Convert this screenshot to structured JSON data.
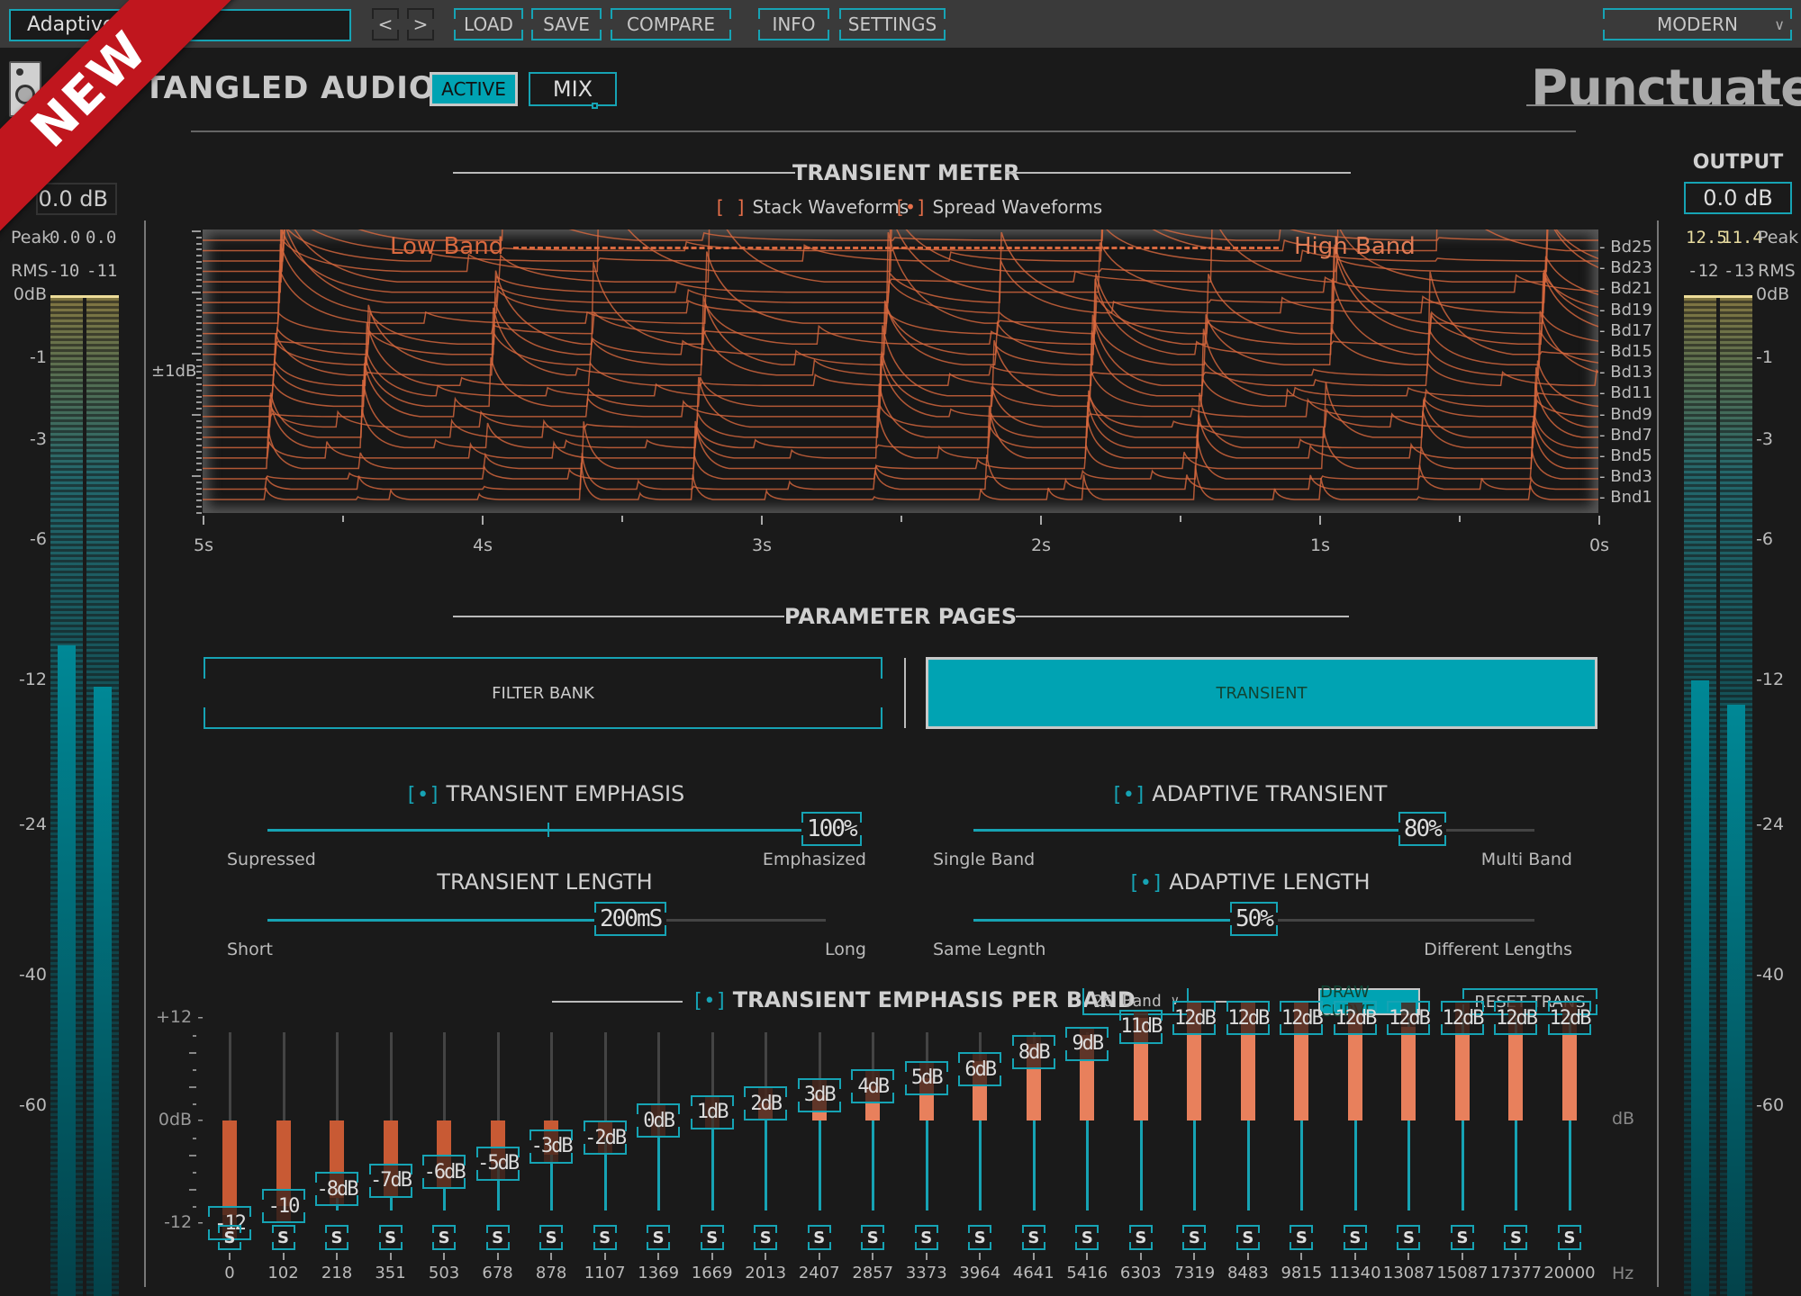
{
  "top_bar": {
    "preset_name": "Adaptive T",
    "prev_label": "<",
    "next_label": ">",
    "load_label": "LOAD",
    "save_label": "SAVE",
    "compare_label": "COMPARE",
    "info_label": "INFO",
    "settings_label": "SETTINGS",
    "style_selected": "MODERN",
    "chevron": "∨"
  },
  "ribbon": {
    "text": "NEW",
    "color": "#c0161e"
  },
  "header": {
    "brand": "TANGLED AUDIO",
    "active_label": "ACTIVE",
    "mix_label": "MIX",
    "plugin_name": "Punctuate"
  },
  "input_meter": {
    "gain_value": "0.0 dB",
    "peak_label": "Peak",
    "peak_l": "0.0",
    "peak_r": "0.0",
    "rms_label": "RMS",
    "rms_l": "-10",
    "rms_r": "-11",
    "scale": [
      "0dB",
      "-1",
      "-3",
      "-6",
      "-12",
      "-24",
      "-40",
      "-60"
    ],
    "level_l_db": -10.5,
    "level_r_db": -12.5
  },
  "output_meter": {
    "title": "OUTPUT",
    "gain_value": "0.0 dB",
    "peak_label": "Peak",
    "peak_l": "12.5",
    "peak_r": "11.4",
    "rms_label": "RMS",
    "rms_l": "-12",
    "rms_r": "-13",
    "scale": [
      "0dB",
      "-1",
      "-3",
      "-6",
      "-12",
      "-24",
      "-40",
      "-60"
    ],
    "level_l_db": -12,
    "level_r_db": -14
  },
  "transient_meter": {
    "title": "TRANSIENT METER",
    "stack_label": "Stack Waveforms",
    "stack_checked": false,
    "spread_label": "Spread Waveforms",
    "spread_checked": true,
    "y_label": "±1dB",
    "low_band_label": "Low Band",
    "high_band_label": "High Band",
    "band_labels": [
      "Bd25",
      "Bd23",
      "Bd21",
      "Bd19",
      "Bd17",
      "Bd15",
      "Bd13",
      "Bd11",
      "Bnd9",
      "Bnd7",
      "Bnd5",
      "Bnd3",
      "Bnd1"
    ],
    "time_labels": [
      "5s",
      "4s",
      "3s",
      "2s",
      "1s",
      "0s"
    ],
    "band_count": 26,
    "transient_times_s": [
      4.78,
      4.45,
      4.0,
      3.65,
      3.25,
      2.6,
      2.2,
      1.85,
      1.45,
      1.0,
      0.65,
      0.25
    ],
    "wave_color": "#d9693f"
  },
  "parameter_pages": {
    "title": "PARAMETER PAGES",
    "tabs": [
      {
        "label": "FILTER BANK",
        "active": false
      },
      {
        "label": "TRANSIENT",
        "active": true
      }
    ]
  },
  "params": {
    "transient_emphasis": {
      "title": "TRANSIENT EMPHASIS",
      "checkbox": "[•]",
      "value": "100%",
      "fraction": 1.0,
      "min_label": "Supressed",
      "max_label": "Emphasized"
    },
    "transient_length": {
      "title": "TRANSIENT LENGTH",
      "value": "200mS",
      "fraction": 0.65,
      "min_label": "Short",
      "max_label": "Long"
    },
    "adaptive_transient": {
      "title": "ADAPTIVE TRANSIENT",
      "checkbox": "[•]",
      "value": "80%",
      "fraction": 0.8,
      "min_label": "Single Band",
      "max_label": "Multi Band"
    },
    "adaptive_length": {
      "title": "ADAPTIVE LENGTH",
      "checkbox": "[•]",
      "value": "50%",
      "fraction": 0.5,
      "min_label": "Same Legnth",
      "max_label": "Different Lengths"
    }
  },
  "per_band": {
    "title": "TRANSIENT EMPHASIS PER BAND",
    "checkbox": "[•]",
    "band_mode": "26 Band",
    "draw_curve_label": "DRAW CURVE",
    "reset_label": "RESET TRANS",
    "y_labels": [
      "+12",
      "0dB",
      "-12"
    ],
    "unit_db": "dB",
    "unit_hz": "Hz",
    "solo_label": "S",
    "bands": [
      {
        "freq": "0",
        "value": "-12",
        "db": -12,
        "activity": -11
      },
      {
        "freq": "102",
        "value": "-10",
        "db": -10,
        "activity": -10
      },
      {
        "freq": "218",
        "value": "-8dB",
        "db": -8,
        "activity": -9
      },
      {
        "freq": "351",
        "value": "-7dB",
        "db": -7,
        "activity": -9
      },
      {
        "freq": "503",
        "value": "-6dB",
        "db": -6,
        "activity": -8
      },
      {
        "freq": "678",
        "value": "-5dB",
        "db": -5,
        "activity": -5
      },
      {
        "freq": "878",
        "value": "-3dB",
        "db": -3,
        "activity": -4
      },
      {
        "freq": "1107",
        "value": "-2dB",
        "db": -2,
        "activity": -2
      },
      {
        "freq": "1369",
        "value": "0dB",
        "db": 0,
        "activity": 0
      },
      {
        "freq": "1669",
        "value": "1dB",
        "db": 1,
        "activity": 0
      },
      {
        "freq": "2013",
        "value": "2dB",
        "db": 2,
        "activity": 2
      },
      {
        "freq": "2407",
        "value": "3dB",
        "db": 3,
        "activity": 3
      },
      {
        "freq": "2857",
        "value": "4dB",
        "db": 4,
        "activity": 4
      },
      {
        "freq": "3373",
        "value": "5dB",
        "db": 5,
        "activity": 5
      },
      {
        "freq": "3964",
        "value": "6dB",
        "db": 6,
        "activity": 7
      },
      {
        "freq": "4641",
        "value": "8dB",
        "db": 8,
        "activity": 9
      },
      {
        "freq": "5416",
        "value": "9dB",
        "db": 9,
        "activity": 10
      },
      {
        "freq": "6303",
        "value": "11dB",
        "db": 11,
        "activity": 12
      },
      {
        "freq": "7319",
        "value": "12dB",
        "db": 12,
        "activity": 14
      },
      {
        "freq": "8483",
        "value": "12dB",
        "db": 12,
        "activity": 14
      },
      {
        "freq": "9815",
        "value": "12dB",
        "db": 12,
        "activity": 14
      },
      {
        "freq": "11340",
        "value": "12dB",
        "db": 12,
        "activity": 12.5
      },
      {
        "freq": "13087",
        "value": "12dB",
        "db": 12,
        "activity": 11
      },
      {
        "freq": "15087",
        "value": "12dB",
        "db": 12,
        "activity": 10
      },
      {
        "freq": "17377",
        "value": "12dB",
        "db": 12,
        "activity": 10
      },
      {
        "freq": "20000",
        "value": "12dB",
        "db": 12,
        "activity": 10
      }
    ]
  },
  "colors": {
    "accent": "#16a3b4",
    "active_fill": "#00a3b3",
    "orange": "#e8704a",
    "bg": "#1a1a1a",
    "topbar": "#3a3a3a"
  }
}
